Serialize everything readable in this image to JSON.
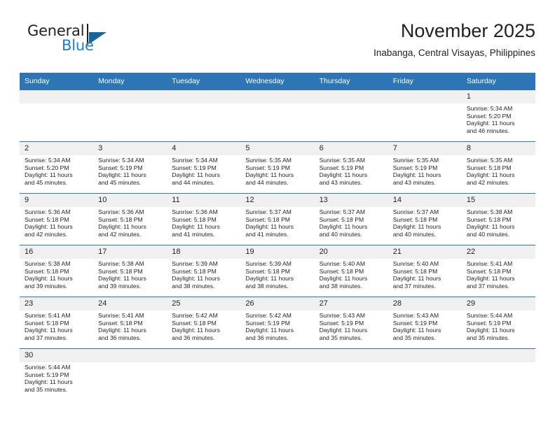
{
  "brand": {
    "line1": "General",
    "line2": "Blue",
    "logo_icon": "blue-triangle-icon",
    "accent_color": "#1b7fd4"
  },
  "header": {
    "title": "November 2025",
    "subtitle": "Inabanga, Central Visayas, Philippines"
  },
  "theme": {
    "header_blue": "#2e75b6",
    "date_band": "#f0f0f0",
    "text": "#231f20"
  },
  "weekdays": [
    "Sunday",
    "Monday",
    "Tuesday",
    "Wednesday",
    "Thursday",
    "Friday",
    "Saturday"
  ],
  "weeks": [
    [
      {
        "empty": true
      },
      {
        "empty": true
      },
      {
        "empty": true
      },
      {
        "empty": true
      },
      {
        "empty": true
      },
      {
        "empty": true
      },
      {
        "day": "1",
        "sunrise": "Sunrise: 5:34 AM",
        "sunset": "Sunset: 5:20 PM",
        "daylight1": "Daylight: 11 hours",
        "daylight2": "and 46 minutes."
      }
    ],
    [
      {
        "day": "2",
        "sunrise": "Sunrise: 5:34 AM",
        "sunset": "Sunset: 5:20 PM",
        "daylight1": "Daylight: 11 hours",
        "daylight2": "and 45 minutes."
      },
      {
        "day": "3",
        "sunrise": "Sunrise: 5:34 AM",
        "sunset": "Sunset: 5:19 PM",
        "daylight1": "Daylight: 11 hours",
        "daylight2": "and 45 minutes."
      },
      {
        "day": "4",
        "sunrise": "Sunrise: 5:34 AM",
        "sunset": "Sunset: 5:19 PM",
        "daylight1": "Daylight: 11 hours",
        "daylight2": "and 44 minutes."
      },
      {
        "day": "5",
        "sunrise": "Sunrise: 5:35 AM",
        "sunset": "Sunset: 5:19 PM",
        "daylight1": "Daylight: 11 hours",
        "daylight2": "and 44 minutes."
      },
      {
        "day": "6",
        "sunrise": "Sunrise: 5:35 AM",
        "sunset": "Sunset: 5:19 PM",
        "daylight1": "Daylight: 11 hours",
        "daylight2": "and 43 minutes."
      },
      {
        "day": "7",
        "sunrise": "Sunrise: 5:35 AM",
        "sunset": "Sunset: 5:19 PM",
        "daylight1": "Daylight: 11 hours",
        "daylight2": "and 43 minutes."
      },
      {
        "day": "8",
        "sunrise": "Sunrise: 5:35 AM",
        "sunset": "Sunset: 5:18 PM",
        "daylight1": "Daylight: 11 hours",
        "daylight2": "and 42 minutes."
      }
    ],
    [
      {
        "day": "9",
        "sunrise": "Sunrise: 5:36 AM",
        "sunset": "Sunset: 5:18 PM",
        "daylight1": "Daylight: 11 hours",
        "daylight2": "and 42 minutes."
      },
      {
        "day": "10",
        "sunrise": "Sunrise: 5:36 AM",
        "sunset": "Sunset: 5:18 PM",
        "daylight1": "Daylight: 11 hours",
        "daylight2": "and 42 minutes."
      },
      {
        "day": "11",
        "sunrise": "Sunrise: 5:36 AM",
        "sunset": "Sunset: 5:18 PM",
        "daylight1": "Daylight: 11 hours",
        "daylight2": "and 41 minutes."
      },
      {
        "day": "12",
        "sunrise": "Sunrise: 5:37 AM",
        "sunset": "Sunset: 5:18 PM",
        "daylight1": "Daylight: 11 hours",
        "daylight2": "and 41 minutes."
      },
      {
        "day": "13",
        "sunrise": "Sunrise: 5:37 AM",
        "sunset": "Sunset: 5:18 PM",
        "daylight1": "Daylight: 11 hours",
        "daylight2": "and 40 minutes."
      },
      {
        "day": "14",
        "sunrise": "Sunrise: 5:37 AM",
        "sunset": "Sunset: 5:18 PM",
        "daylight1": "Daylight: 11 hours",
        "daylight2": "and 40 minutes."
      },
      {
        "day": "15",
        "sunrise": "Sunrise: 5:38 AM",
        "sunset": "Sunset: 5:18 PM",
        "daylight1": "Daylight: 11 hours",
        "daylight2": "and 40 minutes."
      }
    ],
    [
      {
        "day": "16",
        "sunrise": "Sunrise: 5:38 AM",
        "sunset": "Sunset: 5:18 PM",
        "daylight1": "Daylight: 11 hours",
        "daylight2": "and 39 minutes."
      },
      {
        "day": "17",
        "sunrise": "Sunrise: 5:38 AM",
        "sunset": "Sunset: 5:18 PM",
        "daylight1": "Daylight: 11 hours",
        "daylight2": "and 39 minutes."
      },
      {
        "day": "18",
        "sunrise": "Sunrise: 5:39 AM",
        "sunset": "Sunset: 5:18 PM",
        "daylight1": "Daylight: 11 hours",
        "daylight2": "and 38 minutes."
      },
      {
        "day": "19",
        "sunrise": "Sunrise: 5:39 AM",
        "sunset": "Sunset: 5:18 PM",
        "daylight1": "Daylight: 11 hours",
        "daylight2": "and 38 minutes."
      },
      {
        "day": "20",
        "sunrise": "Sunrise: 5:40 AM",
        "sunset": "Sunset: 5:18 PM",
        "daylight1": "Daylight: 11 hours",
        "daylight2": "and 38 minutes."
      },
      {
        "day": "21",
        "sunrise": "Sunrise: 5:40 AM",
        "sunset": "Sunset: 5:18 PM",
        "daylight1": "Daylight: 11 hours",
        "daylight2": "and 37 minutes."
      },
      {
        "day": "22",
        "sunrise": "Sunrise: 5:41 AM",
        "sunset": "Sunset: 5:18 PM",
        "daylight1": "Daylight: 11 hours",
        "daylight2": "and 37 minutes."
      }
    ],
    [
      {
        "day": "23",
        "sunrise": "Sunrise: 5:41 AM",
        "sunset": "Sunset: 5:18 PM",
        "daylight1": "Daylight: 11 hours",
        "daylight2": "and 37 minutes."
      },
      {
        "day": "24",
        "sunrise": "Sunrise: 5:41 AM",
        "sunset": "Sunset: 5:18 PM",
        "daylight1": "Daylight: 11 hours",
        "daylight2": "and 36 minutes."
      },
      {
        "day": "25",
        "sunrise": "Sunrise: 5:42 AM",
        "sunset": "Sunset: 5:18 PM",
        "daylight1": "Daylight: 11 hours",
        "daylight2": "and 36 minutes."
      },
      {
        "day": "26",
        "sunrise": "Sunrise: 5:42 AM",
        "sunset": "Sunset: 5:19 PM",
        "daylight1": "Daylight: 11 hours",
        "daylight2": "and 36 minutes."
      },
      {
        "day": "27",
        "sunrise": "Sunrise: 5:43 AM",
        "sunset": "Sunset: 5:19 PM",
        "daylight1": "Daylight: 11 hours",
        "daylight2": "and 35 minutes."
      },
      {
        "day": "28",
        "sunrise": "Sunrise: 5:43 AM",
        "sunset": "Sunset: 5:19 PM",
        "daylight1": "Daylight: 11 hours",
        "daylight2": "and 35 minutes."
      },
      {
        "day": "29",
        "sunrise": "Sunrise: 5:44 AM",
        "sunset": "Sunset: 5:19 PM",
        "daylight1": "Daylight: 11 hours",
        "daylight2": "and 35 minutes."
      }
    ],
    [
      {
        "day": "30",
        "sunrise": "Sunrise: 5:44 AM",
        "sunset": "Sunset: 5:19 PM",
        "daylight1": "Daylight: 11 hours",
        "daylight2": "and 35 minutes."
      },
      {
        "empty": true
      },
      {
        "empty": true
      },
      {
        "empty": true
      },
      {
        "empty": true
      },
      {
        "empty": true
      },
      {
        "empty": true
      }
    ]
  ]
}
